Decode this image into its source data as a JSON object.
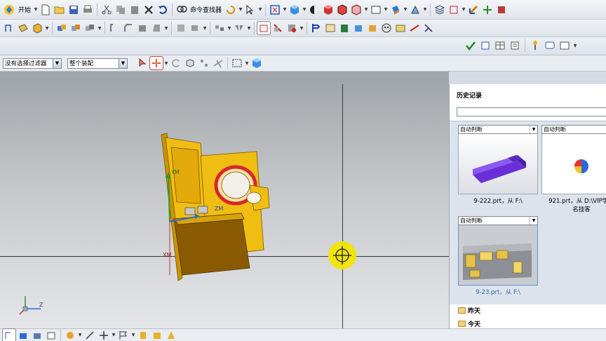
{
  "toolbar": {
    "start_label": "开始",
    "command_finder_label": "命令查找器"
  },
  "selection_bar": {
    "filter_value": "没有选择过滤器",
    "scope_value": "整个装配"
  },
  "viewport": {
    "axis_labels": {
      "z_model": "ZM",
      "y_model": "YM",
      "x_model": "XM",
      "triad_z": "Z"
    },
    "model_colors": {
      "body": "#e8b80a",
      "shade": "#8a5a00",
      "ring": "#d9262b"
    }
  },
  "history_panel": {
    "title": "历史记录",
    "cards": [
      {
        "mode": "自动判断",
        "caption_lines": [
          "9-222.prt，从 F:\\"
        ]
      },
      {
        "mode": "自动判断",
        "caption_lines": [
          "921.prt，从 D:\\VIP学员",
          "名挂客"
        ]
      },
      {
        "mode": "自动判断",
        "caption_lines": [
          "9-23.prt，从 F:\\"
        ]
      }
    ],
    "folders": [
      "昨天",
      "今天"
    ]
  }
}
